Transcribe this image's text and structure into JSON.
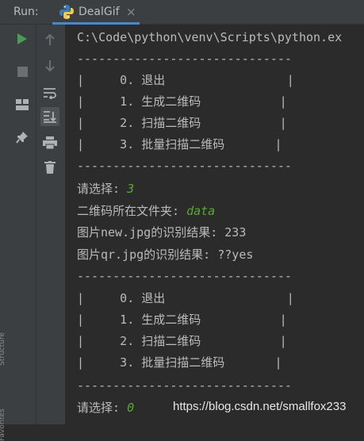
{
  "run_label": "Run:",
  "tab": {
    "title": "DealGif",
    "close": "×"
  },
  "side_tabs": [
    "Structure",
    "Favorites"
  ],
  "console": {
    "lines": [
      "C:\\Code\\python\\venv\\Scripts\\python.ex",
      "------------------------------",
      "|     0. 退出                 |",
      "|     1. 生成二维码           |",
      "|     2. 扫描二维码           |",
      "|     3. 批量扫描二维码       |",
      "------------------------------",
      "",
      "",
      "图片new.jpg的识别结果: 233",
      "图片qr.jpg的识别结果: ??yes",
      "------------------------------",
      "|     0. 退出                 |",
      "|     1. 生成二维码           |",
      "|     2. 扫描二维码           |",
      "|     3. 批量扫描二维码       |",
      "------------------------------",
      ""
    ],
    "prompt1": "请选择: ",
    "input1": "3",
    "prompt2": "二维码所在文件夹: ",
    "input2": "data",
    "prompt3": "请选择: ",
    "input3": "0"
  },
  "watermark": "https://blog.csdn.net/smallfox233"
}
